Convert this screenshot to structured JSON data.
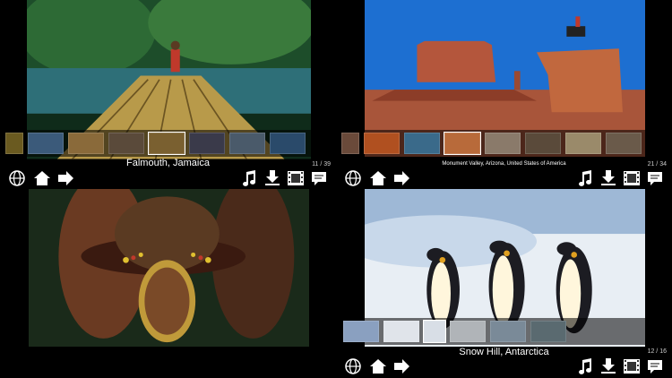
{
  "panes": [
    {
      "caption": "Falmouth, Jamaica",
      "counter": "11 / 39"
    },
    {
      "caption": "Monument Valley, Arizona, United States of America",
      "counter": "21 / 34"
    },
    {
      "caption": "",
      "counter": ""
    },
    {
      "caption": "Snow Hill, Antarctica",
      "counter": "12 / 16"
    }
  ],
  "icons": [
    "globe-icon",
    "home-icon",
    "next-arrow-icon",
    "music-icon",
    "download-icon",
    "film-icon",
    "speech-bubble-icon"
  ],
  "colors": {
    "background": "#000000",
    "caption_text": "#ffffff"
  }
}
